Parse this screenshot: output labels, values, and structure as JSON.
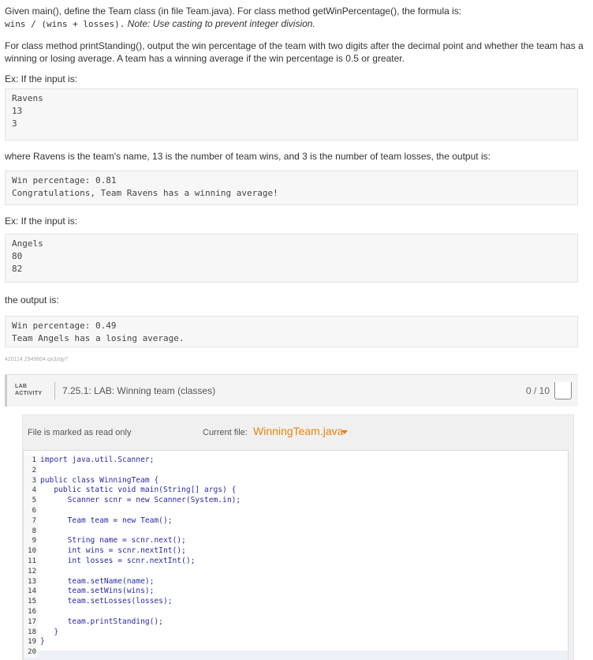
{
  "instructions": {
    "p1": "Given main(), define the Team class (in file Team.java). For class method getWinPercentage(), the formula is:",
    "formula": "wins / (wins + losses).",
    "formula_note": "Note: Use casting to prevent integer division.",
    "p2": "For class method printStanding(), output the win percentage of the team with two digits after the decimal point and whether the team has a winning or losing average. A team has a winning average if the win percentage is 0.5 or greater.",
    "ex1_label": "Ex: If the input is:",
    "ex1_input": [
      "Ravens",
      "13",
      "3"
    ],
    "ex1_explain": "where Ravens is the team's name, 13 is the number of team wins, and 3 is the number of team losses, the output is:",
    "ex1_output": [
      "Win percentage: 0.81",
      "Congratulations, Team Ravens has a winning average!"
    ],
    "ex2_label": "Ex: If the input is:",
    "ex2_input": [
      "Angels",
      "80",
      "82"
    ],
    "ex2_explain": "the output is:",
    "ex2_output": [
      "Win percentage: 0.49",
      "Team Angels has a losing average."
    ],
    "id_tag": "420114.2949604.qx3zqy7"
  },
  "lab": {
    "badge_line1": "LAB",
    "badge_line2": "ACTIVITY",
    "title": "7.25.1: LAB: Winning team (classes)",
    "score": "0 / 10",
    "readonly_text": "File is marked as read only",
    "current_file_label": "Current file:",
    "current_file_name": "WinningTeam.java",
    "line_numbers": [
      "1",
      "2",
      "3",
      "4",
      "5",
      "6",
      "7",
      "8",
      "9",
      "10",
      "11",
      "12",
      "13",
      "14",
      "15",
      "16",
      "17",
      "18",
      "19",
      "20"
    ],
    "code_lines": [
      "import java.util.Scanner;",
      "",
      "public class WinningTeam {",
      "   public static void main(String[] args) {",
      "      Scanner scnr = new Scanner(System.in);",
      "",
      "      Team team = new Team();",
      "",
      "      String name = scnr.next();",
      "      int wins = scnr.nextInt();",
      "      int losses = scnr.nextInt();",
      "",
      "      team.setName(name);",
      "      team.setWins(wins);",
      "      team.setLosses(losses);",
      "",
      "      team.printStanding();",
      "   }",
      "}",
      ""
    ]
  }
}
